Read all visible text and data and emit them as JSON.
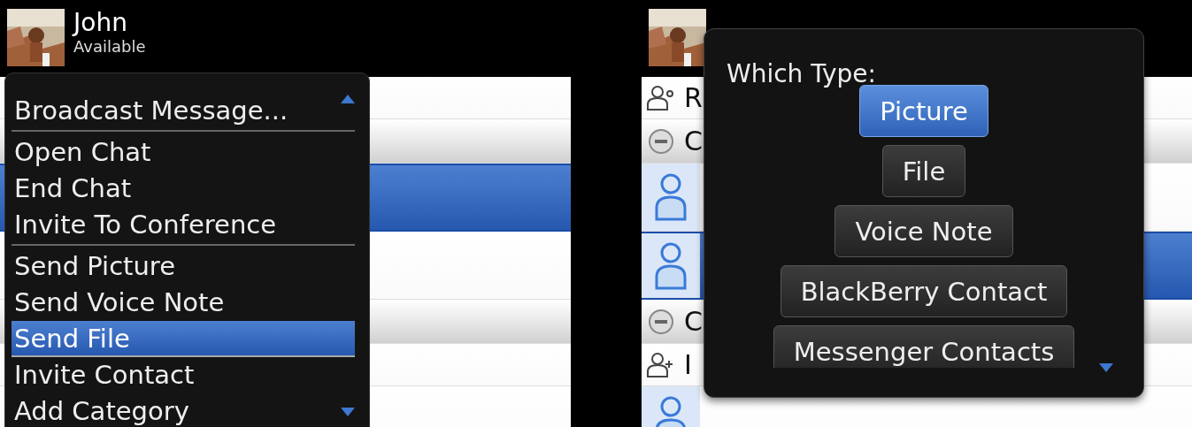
{
  "screens": [
    {
      "header": {
        "name": "John",
        "status": "Available"
      },
      "contact_list": {
        "rows": [
          {
            "kind": "pending",
            "selected": false
          },
          {
            "kind": "group",
            "selected": false
          },
          {
            "kind": "contact",
            "selected": true
          },
          {
            "kind": "contact",
            "selected": false
          },
          {
            "kind": "group",
            "selected": false
          },
          {
            "kind": "invite",
            "selected": false
          },
          {
            "kind": "contact",
            "selected": false
          }
        ]
      },
      "menu": {
        "more_above": true,
        "more_below": true,
        "items": [
          {
            "kind": "item",
            "label": "Broadcast Message...",
            "selected": false
          },
          {
            "kind": "separator"
          },
          {
            "kind": "item",
            "label": "Open Chat",
            "selected": false
          },
          {
            "kind": "item",
            "label": "End Chat",
            "selected": false
          },
          {
            "kind": "item",
            "label": "Invite To Conference",
            "selected": false
          },
          {
            "kind": "separator"
          },
          {
            "kind": "item",
            "label": "Send Picture",
            "selected": false
          },
          {
            "kind": "item",
            "label": "Send Voice Note",
            "selected": false
          },
          {
            "kind": "item",
            "label": "Send File",
            "selected": true
          },
          {
            "kind": "item",
            "label": "Invite Contact",
            "selected": false
          },
          {
            "kind": "item",
            "label": "Add Category",
            "selected": false
          }
        ]
      }
    },
    {
      "contact_list": {
        "rows": [
          {
            "kind": "pending",
            "label": "R",
            "selected": false
          },
          {
            "kind": "group",
            "label": "C",
            "selected": false
          },
          {
            "kind": "contact",
            "selected": false
          },
          {
            "kind": "contact",
            "selected": true
          },
          {
            "kind": "group",
            "label": "C",
            "selected": false
          },
          {
            "kind": "invite",
            "label": "I",
            "selected": false
          },
          {
            "kind": "contact",
            "selected": false
          }
        ]
      },
      "dialog": {
        "title": "Which Type:",
        "more_below": true,
        "options": [
          {
            "label": "Picture",
            "selected": true
          },
          {
            "label": "File",
            "selected": false
          },
          {
            "label": "Voice Note",
            "selected": false
          },
          {
            "label": "BlackBerry Contact",
            "selected": false
          },
          {
            "label": "Messenger Contacts",
            "selected": false
          }
        ]
      }
    }
  ]
}
